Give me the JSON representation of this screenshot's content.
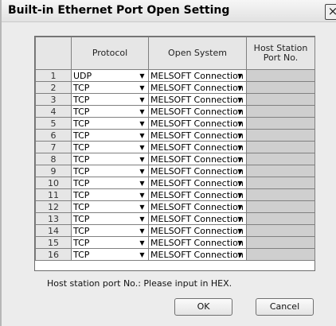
{
  "window": {
    "title": "Built-in Ethernet Port Open Setting",
    "close_glyph": "×"
  },
  "table": {
    "headers": {
      "protocol": "Protocol",
      "open_system": "Open System",
      "host_line1": "Host Station",
      "host_line2": "Port No."
    },
    "rows": [
      {
        "num": "1",
        "protocol": "UDP",
        "open_system": "MELSOFT Connection",
        "host": ""
      },
      {
        "num": "2",
        "protocol": "TCP",
        "open_system": "MELSOFT Connection",
        "host": ""
      },
      {
        "num": "3",
        "protocol": "TCP",
        "open_system": "MELSOFT Connection",
        "host": ""
      },
      {
        "num": "4",
        "protocol": "TCP",
        "open_system": "MELSOFT Connection",
        "host": ""
      },
      {
        "num": "5",
        "protocol": "TCP",
        "open_system": "MELSOFT Connection",
        "host": ""
      },
      {
        "num": "6",
        "protocol": "TCP",
        "open_system": "MELSOFT Connection",
        "host": ""
      },
      {
        "num": "7",
        "protocol": "TCP",
        "open_system": "MELSOFT Connection",
        "host": ""
      },
      {
        "num": "8",
        "protocol": "TCP",
        "open_system": "MELSOFT Connection",
        "host": ""
      },
      {
        "num": "9",
        "protocol": "TCP",
        "open_system": "MELSOFT Connection",
        "host": ""
      },
      {
        "num": "10",
        "protocol": "TCP",
        "open_system": "MELSOFT Connection",
        "host": ""
      },
      {
        "num": "11",
        "protocol": "TCP",
        "open_system": "MELSOFT Connection",
        "host": ""
      },
      {
        "num": "12",
        "protocol": "TCP",
        "open_system": "MELSOFT Connection",
        "host": ""
      },
      {
        "num": "13",
        "protocol": "TCP",
        "open_system": "MELSOFT Connection",
        "host": ""
      },
      {
        "num": "14",
        "protocol": "TCP",
        "open_system": "MELSOFT Connection",
        "host": ""
      },
      {
        "num": "15",
        "protocol": "TCP",
        "open_system": "MELSOFT Connection",
        "host": ""
      },
      {
        "num": "16",
        "protocol": "TCP",
        "open_system": "MELSOFT Connection",
        "host": ""
      }
    ]
  },
  "note": "Host station port No.: Please input in HEX.",
  "buttons": {
    "ok": "OK",
    "cancel": "Cancel"
  },
  "icons": {
    "dropdown_arrow": "chevron-down-icon",
    "close": "close-icon"
  },
  "colors": {
    "dialog_bg": "#ececec",
    "header_bg": "#e6e6e6",
    "host_cell_bg": "#cfcfcf",
    "grid_line": "#808080"
  }
}
